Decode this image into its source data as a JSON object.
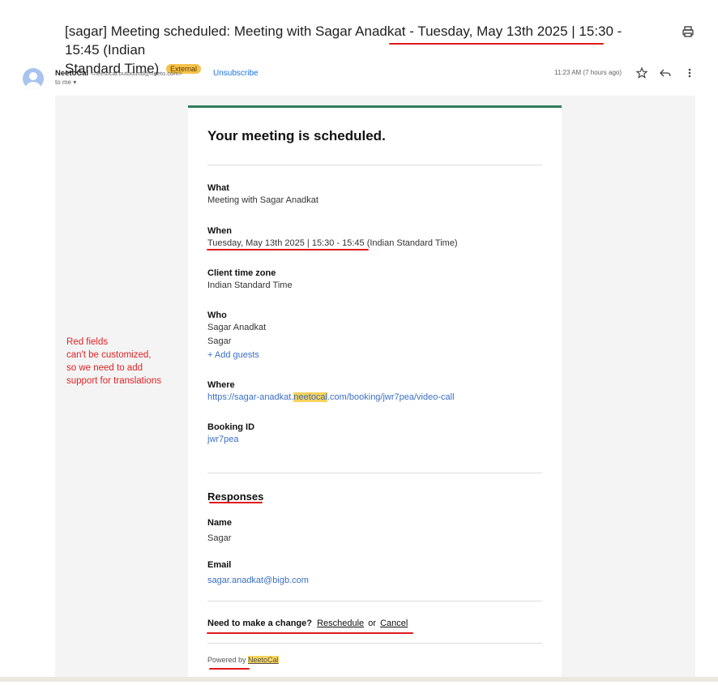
{
  "email": {
    "subject_prefix": "[sagar] Meeting scheduled: Meeting with Sagar Anadkat - Tuesday, May 13th 2025 | 15:30 - 15:45 (Indian",
    "subject_line2": "Standard Time)",
    "external_badge": "External",
    "sender_name": "NeetoCal",
    "sender_address": "<neetocal.outbound@neeto.com>",
    "unsubscribe": "Unsubscribe",
    "to_me": "to me ▾",
    "timestamp": "11:23 AM (7 hours ago)"
  },
  "card": {
    "heading": "Your meeting is scheduled.",
    "what_label": "What",
    "what_value": "Meeting with Sagar Anadkat",
    "when_label": "When",
    "when_value": "Tuesday, May 13th 2025 | 15:30 - 15:45 (Indian Standard Time)",
    "tz_label": "Client time zone",
    "tz_value": "Indian Standard Time",
    "who_label": "Who",
    "who_name1": "Sagar Anadkat",
    "who_name2": "Sagar",
    "add_guests": "+ Add guests",
    "where_label": "Where",
    "where_pre": "https://sagar-anadkat.",
    "where_hl": "neetocal",
    "where_post": ".com/booking/jwr7pea/video-call",
    "booking_label": "Booking ID",
    "booking_value": "jwr7pea",
    "responses_heading": "Responses",
    "name_label": "Name",
    "name_value": "Sagar",
    "email_label": "Email",
    "email_value": "sagar.anadkat@bigb.com",
    "change_text": "Need to make a change?",
    "reschedule": "Reschedule",
    "or": "or",
    "cancel": "Cancel",
    "powered_by": "Powered by",
    "powered_brand": "NeetoCal"
  },
  "annotation": {
    "line1": "Red fields",
    "line2": "can't be customized,",
    "line3": "so we need to add",
    "line4": "support for translations"
  },
  "colors": {
    "accent_green": "#2f7d5b",
    "annotation_red": "#e02424",
    "highlight_yellow": "#f7d35c",
    "link_blue": "#3b6fc4"
  }
}
